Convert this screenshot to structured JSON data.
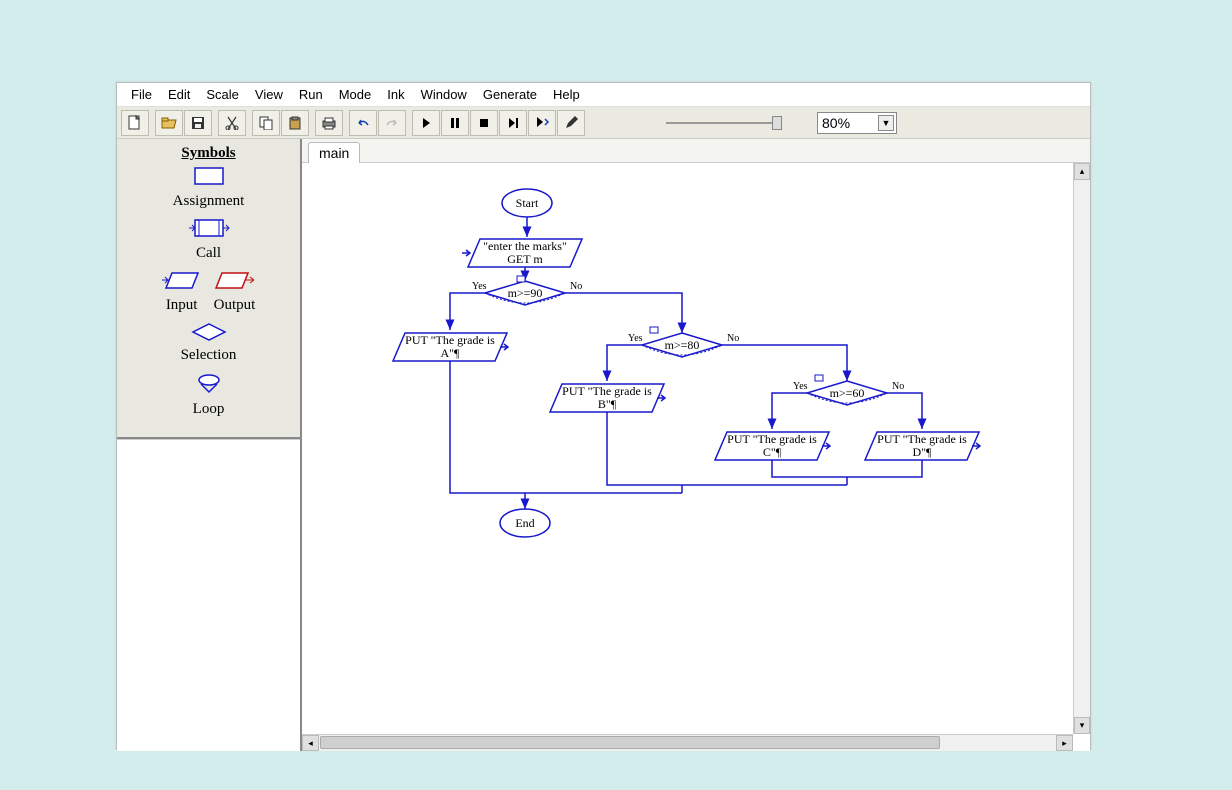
{
  "menu": [
    "File",
    "Edit",
    "Scale",
    "View",
    "Run",
    "Mode",
    "Ink",
    "Window",
    "Generate",
    "Help"
  ],
  "toolbar": {
    "zoom_value": "80%",
    "icons": [
      "new",
      "open",
      "save",
      "cut",
      "copy",
      "paste",
      "print",
      "undo",
      "redo",
      "run",
      "pause",
      "stop",
      "step",
      "step-into",
      "pen"
    ]
  },
  "sidebar": {
    "title": "Symbols",
    "items": [
      "Assignment",
      "Call",
      "Input",
      "Output",
      "Selection",
      "Loop"
    ]
  },
  "tab": {
    "label": "main"
  },
  "flowchart": {
    "start": "Start",
    "end": "End",
    "input_line1": "\"enter the marks\"",
    "input_line2": "GET m",
    "dec1": "m>=90",
    "dec2": "m>=80",
    "dec3": "m>=60",
    "out_a_line1": "PUT \"The grade is",
    "out_a_line2": "A\"¶",
    "out_b_line1": "PUT \"The grade is",
    "out_b_line2": "B\"¶",
    "out_c_line1": "PUT \"The grade is",
    "out_c_line2": "C\"¶",
    "out_d_line1": "PUT \"The grade is",
    "out_d_line2": "D\"¶",
    "yes": "Yes",
    "no": "No"
  }
}
